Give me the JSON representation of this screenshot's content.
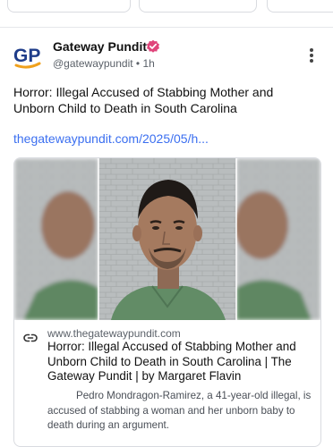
{
  "post": {
    "author_name": "Gateway Pundit",
    "logo_text": "GP",
    "handle_time": "@gatewaypundit • 1h",
    "text": "Horror: Illegal Accused of Stabbing Mother and Unborn Child to Death in South Carolina",
    "link_text": "thegatewaypundit.com/2025/05/h...",
    "colors": {
      "link": "#3b6ff0",
      "verified": "#e0457b",
      "logo_blue": "#1f3d8a",
      "logo_orange": "#f0a11c"
    }
  },
  "card": {
    "domain": "www.thegatewaypundit.com",
    "title": "Horror: Illegal Accused of Stabbing Mother and Unborn Child to Death in South Carolina | The Gateway Pundit | by Margaret Flavin",
    "description": "Pedro Mondragon-Ramirez, a 41-year-old illegal, is accused of stabbing a woman and her unborn baby to death during an argument.",
    "image_icon": "mugshot-photo",
    "link_icon": "link-icon"
  },
  "icons": {
    "verified": "verified-badge-icon",
    "more": "more-options-icon"
  }
}
